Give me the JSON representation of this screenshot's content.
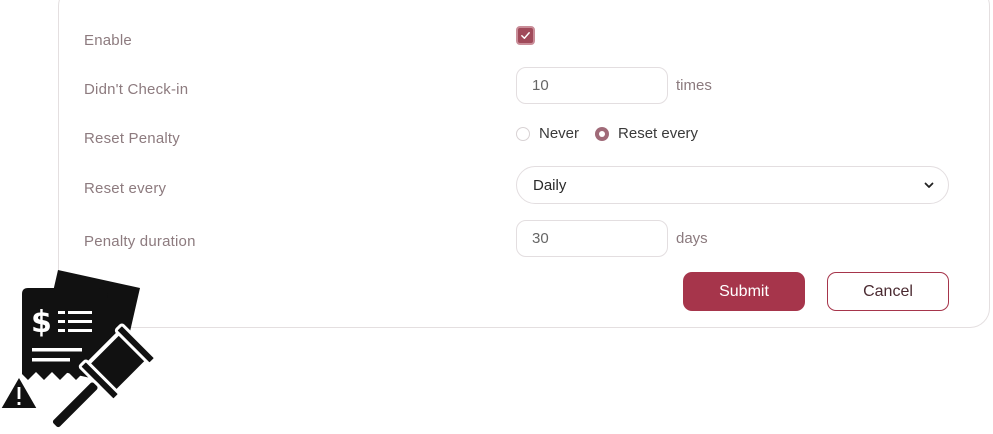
{
  "form": {
    "enable": {
      "label": "Enable",
      "checked": true
    },
    "didnt_checkin": {
      "label": "Didn't Check-in",
      "value": "10",
      "suffix": "times"
    },
    "reset_penalty": {
      "label": "Reset Penalty",
      "options": [
        {
          "label": "Never",
          "selected": false
        },
        {
          "label": "Reset every",
          "selected": true
        }
      ]
    },
    "reset_every": {
      "label": "Reset every",
      "selected": "Daily"
    },
    "penalty_duration": {
      "label": "Penalty duration",
      "value": "30",
      "suffix": "days"
    }
  },
  "actions": {
    "submit_label": "Submit",
    "cancel_label": "Cancel"
  },
  "colors": {
    "accent": "#a6354b",
    "label": "#8d7b7f",
    "border": "#e3dee0"
  },
  "icons": {
    "illustration": "penalty-fine-gavel-icon",
    "warning": "warning-triangle-icon",
    "dollar": "dollar-sign-icon"
  }
}
